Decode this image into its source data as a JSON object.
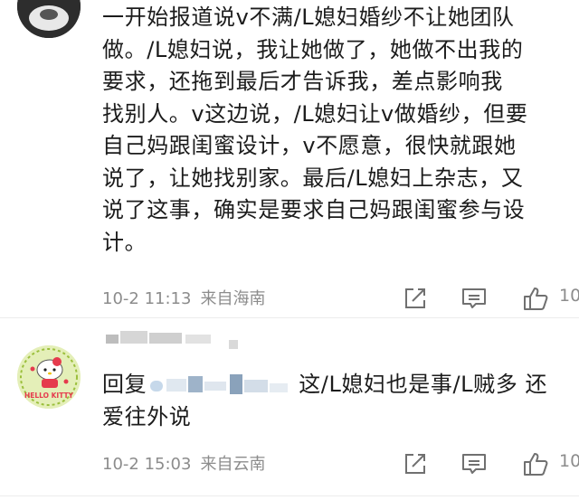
{
  "comments": [
    {
      "text": "一开始报道说v不满/L媳妇婚纱不让她团队\n做。/L媳妇说，我让她做了，她做不出我的\n要求，还拖到最后才告诉我，差点影响我\n找别人。v这边说，/L媳妇让v做婚纱，但要\n自己妈跟闺蜜设计，v不愿意，很快就跟她\n说了，让她找别家。最后/L媳妇上杂志，又\n说了这事，确实是要求自己妈跟闺蜜参与设\n计。",
      "date": "10-2 11:13",
      "location": "来自海南",
      "likes": "10",
      "avatar_icon": "dog-avatar-icon"
    },
    {
      "reply_prefix": "回复",
      "reply_suffix": "这/L媳妇也是事/L贼多 还\n爱往外说",
      "date": "10-2 15:03",
      "location": "来自云南",
      "likes": "10",
      "avatar_text": "HELLO KITTY"
    }
  ],
  "colors": {
    "meta": "#8c8c8c",
    "text": "#1c1c1c",
    "avatar2_bg": "#e4efb8"
  }
}
